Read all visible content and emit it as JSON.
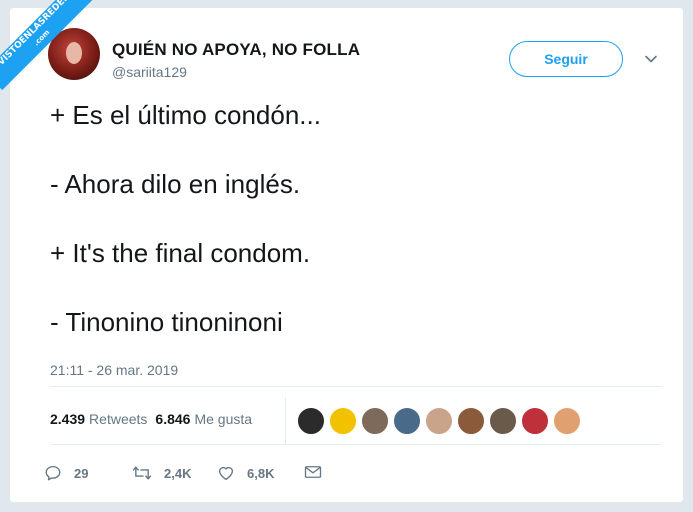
{
  "watermark": {
    "text": "VISTOENLASREDES",
    "sub": ".com"
  },
  "author": {
    "display_name": "QUIÉN NO APOYA, NO FOLLA",
    "handle": "@sariita129"
  },
  "follow_button": {
    "label": "Seguir"
  },
  "tweet": {
    "lines": [
      "+ Es el último condón...",
      "- Ahora dilo en inglés.",
      "+ It's the final condom.",
      "- Tinonino tinoninoni"
    ],
    "timestamp": "21:11 - 26 mar. 2019"
  },
  "stats": {
    "retweets_count": "2.439",
    "retweets_label": "Retweets",
    "likes_count": "6.846",
    "likes_label": "Me gusta"
  },
  "likers": [
    {
      "color": "#2b2b2b"
    },
    {
      "color": "#f2c200"
    },
    {
      "color": "#7d6a5a"
    },
    {
      "color": "#4a6a8a"
    },
    {
      "color": "#c9a48a"
    },
    {
      "color": "#8a5a3a"
    },
    {
      "color": "#6a5a4a"
    },
    {
      "color": "#c0303a"
    },
    {
      "color": "#e0a070"
    }
  ],
  "actions": {
    "reply_count": "29",
    "retweet_count": "2,4K",
    "like_count": "6,8K"
  },
  "colors": {
    "accent": "#1da1f2",
    "text": "#14171a",
    "muted": "#657786"
  }
}
